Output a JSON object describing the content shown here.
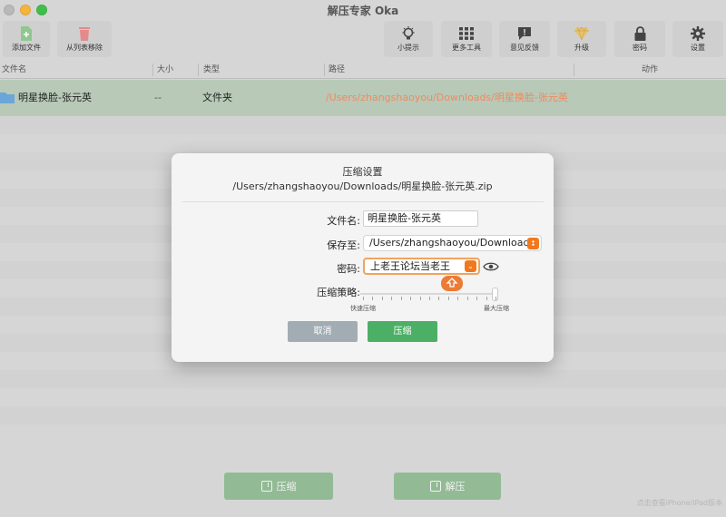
{
  "window": {
    "title": "解压专家 Oka"
  },
  "toolbar": {
    "add_file": "添加文件",
    "remove": "从列表移除",
    "tips": "小提示",
    "more_tools": "更多工具",
    "feedback": "意见反馈",
    "upgrade": "升级",
    "password": "密码",
    "settings": "设置"
  },
  "table": {
    "headers": {
      "name": "文件名",
      "size": "大小",
      "type": "类型",
      "path": "路径",
      "action": "动作"
    },
    "rows": [
      {
        "name": "明星换脸-张元英",
        "size": "--",
        "type": "文件夹",
        "path": "/Users/zhangshaoyou/Downloads/明星换脸-张元英"
      }
    ]
  },
  "bottom": {
    "compress": "压缩",
    "extract": "解压",
    "note": "点击查看iPhone/iPad版本"
  },
  "dialog": {
    "title": "压缩设置",
    "subtitle": "/Users/zhangshaoyou/Downloads/明星换脸-张元英.zip",
    "filename_label": "文件名:",
    "filename_value": "明星换脸-张元英",
    "saveto_label": "保存至:",
    "saveto_value": "/Users/zhangshaoyou/Downloads",
    "password_label": "密码:",
    "password_value": "上老王论坛当老王",
    "strategy_label": "压缩策略:",
    "strategy_min": "快速压缩",
    "strategy_max": "最大压缩",
    "strategy_level": 1.0,
    "cancel": "取消",
    "confirm": "压缩"
  },
  "colors": {
    "accent_green": "#4caf66",
    "accent_orange": "#f0781e",
    "path_text": "#f08a5d"
  }
}
